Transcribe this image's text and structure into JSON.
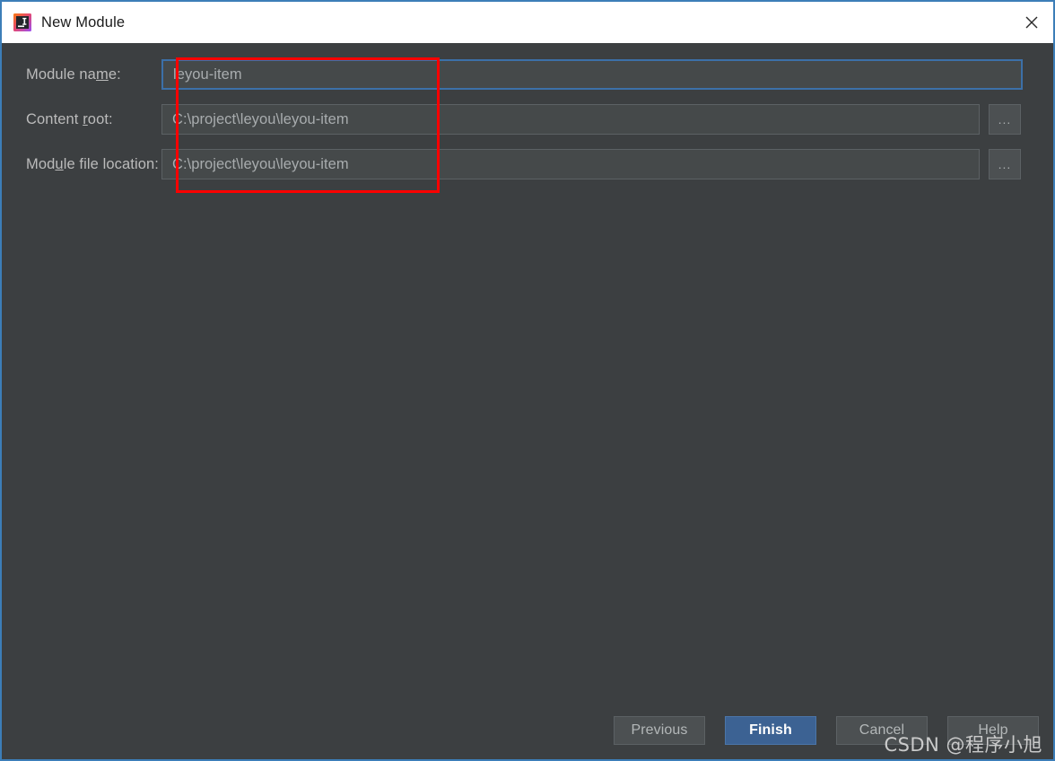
{
  "window": {
    "title": "New Module",
    "app_icon": "intellij-idea-icon",
    "close_icon": "close-icon",
    "accent_color": "#3c7eb8",
    "background_color": "#3c3f41"
  },
  "form": {
    "rows": [
      {
        "label_pre": "Module na",
        "label_mnemonic": "m",
        "label_post": "e:",
        "value": "leyou-item",
        "focused": true,
        "has_browse": false,
        "field_name": "module-name"
      },
      {
        "label_pre": "Content ",
        "label_mnemonic": "r",
        "label_post": "oot:",
        "value": "C:\\project\\leyou\\leyou-item",
        "focused": false,
        "has_browse": true,
        "field_name": "content-root"
      },
      {
        "label_pre": "Mod",
        "label_mnemonic": "u",
        "label_post": "le file location:",
        "value": "C:\\project\\leyou\\leyou-item",
        "focused": false,
        "has_browse": true,
        "field_name": "module-file-location"
      }
    ],
    "browse_label": "...",
    "annotation_color": "#ff0000"
  },
  "footer": {
    "buttons": [
      {
        "label": "Previous",
        "name": "previous-button",
        "primary": false
      },
      {
        "label": "Finish",
        "name": "finish-button",
        "primary": true
      },
      {
        "label": "Cancel",
        "name": "cancel-button",
        "primary": false
      },
      {
        "label": "Help",
        "name": "help-button",
        "primary": false
      }
    ],
    "primary_color": "#3c6293"
  },
  "watermark": {
    "text": "CSDN @程序小旭"
  }
}
